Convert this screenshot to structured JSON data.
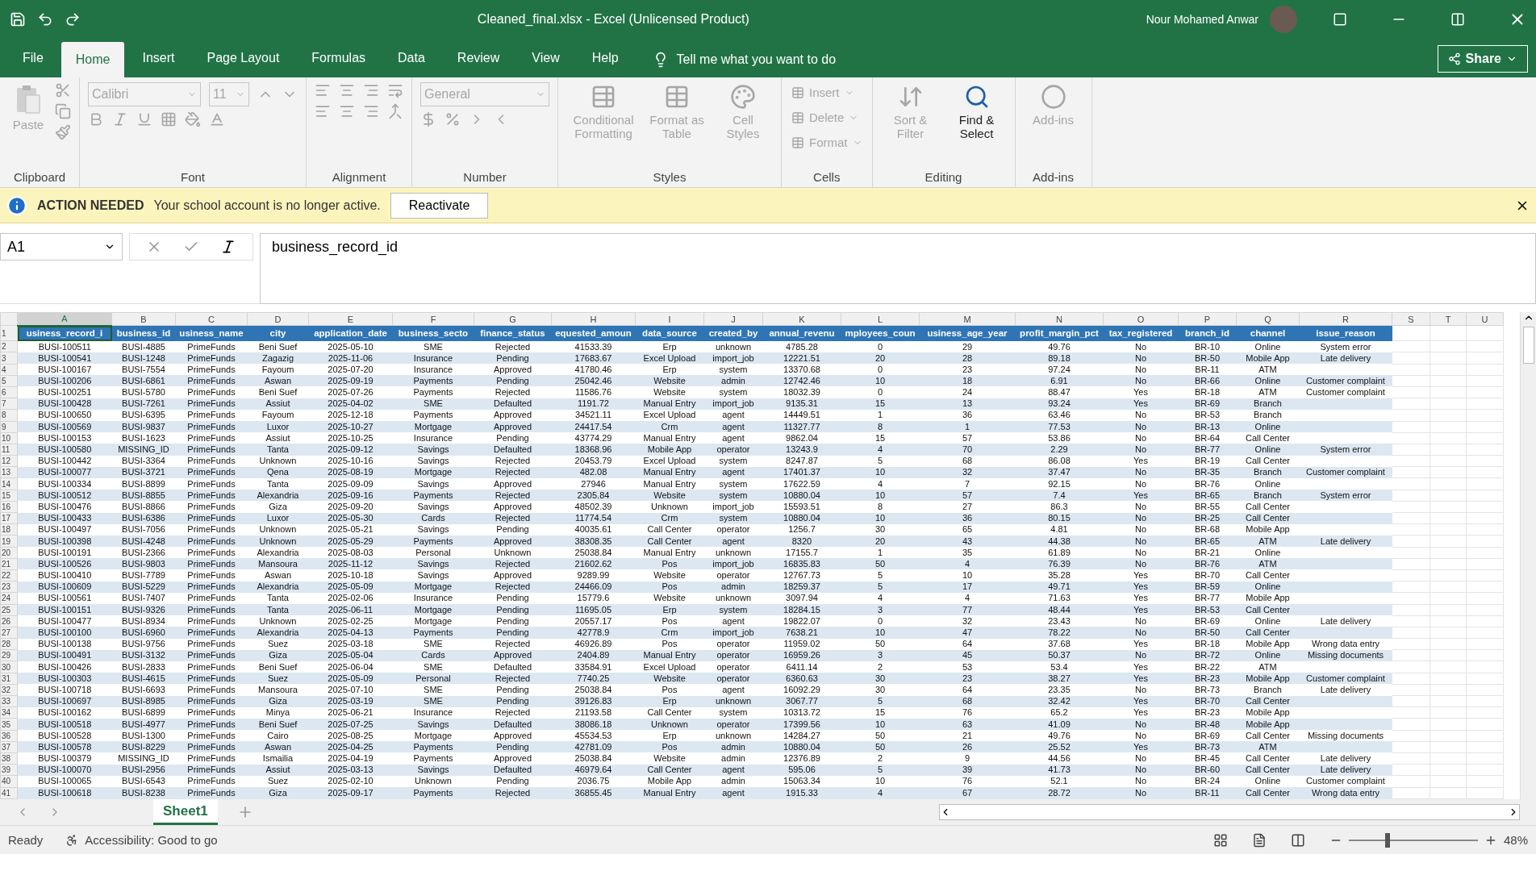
{
  "window": {
    "title": "Cleaned_final.xlsx  -  Excel (Unlicensed Product)",
    "user": "Nour Mohamed Anwar"
  },
  "ribbon_tabs": [
    {
      "label": "File",
      "selected": false
    },
    {
      "label": "Home",
      "selected": true
    },
    {
      "label": "Insert",
      "selected": false
    },
    {
      "label": "Page Layout",
      "selected": false
    },
    {
      "label": "Formulas",
      "selected": false
    },
    {
      "label": "Data",
      "selected": false
    },
    {
      "label": "Review",
      "selected": false
    },
    {
      "label": "View",
      "selected": false
    },
    {
      "label": "Help",
      "selected": false
    }
  ],
  "tell_me": "Tell me what you want to do",
  "share": "Share",
  "ribbon_groups": [
    {
      "kind": "clipboard",
      "label": "Clipboard",
      "items": [
        {
          "label": "Paste",
          "disabled": true
        }
      ]
    },
    {
      "kind": "font",
      "label": "Font",
      "font": "Calibri",
      "size": "11"
    },
    {
      "kind": "alignment",
      "label": "Alignment"
    },
    {
      "kind": "number",
      "label": "Number",
      "format": "General"
    },
    {
      "kind": "large",
      "label": "Styles",
      "items": [
        {
          "label": "Conditional Formatting",
          "disabled": true
        },
        {
          "label": "Format as Table",
          "disabled": true
        },
        {
          "label": "Cell Styles",
          "disabled": true
        }
      ]
    },
    {
      "kind": "small",
      "label": "Cells",
      "items": [
        {
          "label": "Insert",
          "disabled": true
        },
        {
          "label": "Delete",
          "disabled": true
        },
        {
          "label": "Format",
          "disabled": true
        }
      ]
    },
    {
      "kind": "large",
      "label": "Editing",
      "items": [
        {
          "label": "Sort & Filter",
          "disabled": true
        },
        {
          "label": "Find & Select",
          "disabled": false
        }
      ]
    },
    {
      "kind": "large",
      "label": "Add-ins",
      "items": [
        {
          "label": "Add-ins",
          "disabled": true
        }
      ]
    }
  ],
  "info_bar": {
    "title": "ACTION NEEDED",
    "message": "Your school account is no longer active.",
    "button": "Reactivate"
  },
  "formula_bar": {
    "name_box": "A1",
    "formula": "business_record_id"
  },
  "sheet": {
    "header_row": "1",
    "columns": [
      {
        "letter": "A",
        "header": "usiness_record_i",
        "selected": true
      },
      {
        "letter": "B",
        "header": "business_id",
        "selected": false
      },
      {
        "letter": "C",
        "header": "usiness_name",
        "selected": false
      },
      {
        "letter": "D",
        "header": "city",
        "selected": false
      },
      {
        "letter": "E",
        "header": "application_date",
        "selected": false
      },
      {
        "letter": "F",
        "header": "business_secto",
        "selected": false
      },
      {
        "letter": "G",
        "header": "finance_status",
        "selected": false
      },
      {
        "letter": "H",
        "header": "equested_amoun",
        "selected": false
      },
      {
        "letter": "I",
        "header": "data_source",
        "selected": false
      },
      {
        "letter": "J",
        "header": "created_by",
        "selected": false
      },
      {
        "letter": "K",
        "header": "annual_revenu",
        "selected": false
      },
      {
        "letter": "L",
        "header": "mployees_coun",
        "selected": false
      },
      {
        "letter": "M",
        "header": "usiness_age_year",
        "selected": false
      },
      {
        "letter": "N",
        "header": "profit_margin_pct",
        "selected": false
      },
      {
        "letter": "O",
        "header": "tax_registered",
        "selected": false
      },
      {
        "letter": "P",
        "header": "branch_id",
        "selected": false
      },
      {
        "letter": "Q",
        "header": "channel",
        "selected": false
      },
      {
        "letter": "R",
        "header": "issue_reason",
        "selected": false
      }
    ],
    "extra_columns": [
      "S",
      "T",
      "U"
    ],
    "rows": [
      {
        "n": "2",
        "cells": [
          "BUSI-100511",
          "BUSI-4885",
          "PrimeFunds",
          "Beni Suef",
          "2025-05-10",
          "SME",
          "Rejected",
          "41533.39",
          "Erp",
          "unknown",
          "4785.28",
          "0",
          "29",
          "49.76",
          "No",
          "BR-10",
          "Online",
          "System error"
        ]
      },
      {
        "n": "3",
        "cells": [
          "BUSI-100541",
          "BUSI-1248",
          "PrimeFunds",
          "Zagazig",
          "2025-11-06",
          "Insurance",
          "Pending",
          "17683.67",
          "Excel Upload",
          "import_job",
          "12221.51",
          "20",
          "28",
          "89.18",
          "No",
          "BR-50",
          "Mobile App",
          "Late delivery"
        ]
      },
      {
        "n": "4",
        "cells": [
          "BUSI-100167",
          "BUSI-7554",
          "PrimeFunds",
          "Fayoum",
          "2025-07-20",
          "Insurance",
          "Approved",
          "41780.46",
          "Erp",
          "system",
          "13370.68",
          "0",
          "23",
          "97.24",
          "No",
          "BR-11",
          "ATM"
        ]
      },
      {
        "n": "5",
        "cells": [
          "BUSI-100206",
          "BUSI-6861",
          "PrimeFunds",
          "Aswan",
          "2025-09-19",
          "Payments",
          "Pending",
          "25042.46",
          "Website",
          "admin",
          "12742.46",
          "10",
          "18",
          "6.91",
          "No",
          "BR-66",
          "Online",
          "Customer complaint"
        ]
      },
      {
        "n": "6",
        "cells": [
          "BUSI-100251",
          "BUSI-5780",
          "PrimeFunds",
          "Beni Suef",
          "2025-07-26",
          "Payments",
          "Rejected",
          "11586.76",
          "Website",
          "system",
          "18032.39",
          "0",
          "24",
          "88.47",
          "Yes",
          "BR-18",
          "ATM",
          "Customer complaint"
        ]
      },
      {
        "n": "7",
        "cells": [
          "BUSI-100428",
          "BUSI-7261",
          "PrimeFunds",
          "Assiut",
          "2025-04-02",
          "SME",
          "Defaulted",
          "1191.72",
          "Manual Entry",
          "import_job",
          "9135.31",
          "15",
          "13",
          "93.24",
          "Yes",
          "BR-69",
          "Branch"
        ]
      },
      {
        "n": "8",
        "cells": [
          "BUSI-100650",
          "BUSI-6395",
          "PrimeFunds",
          "Fayoum",
          "2025-12-18",
          "Payments",
          "Approved",
          "34521.11",
          "Excel Upload",
          "agent",
          "14449.51",
          "1",
          "36",
          "63.46",
          "No",
          "BR-53",
          "Branch"
        ]
      },
      {
        "n": "9",
        "cells": [
          "BUSI-100569",
          "BUSI-9837",
          "PrimeFunds",
          "Luxor",
          "2025-10-27",
          "Mortgage",
          "Approved",
          "24417.54",
          "Crm",
          "agent",
          "11327.77",
          "8",
          "1",
          "77.53",
          "No",
          "BR-13",
          "Online"
        ]
      },
      {
        "n": "10",
        "cells": [
          "BUSI-100153",
          "BUSI-1623",
          "PrimeFunds",
          "Assiut",
          "2025-10-25",
          "Insurance",
          "Pending",
          "43774.29",
          "Manual Entry",
          "agent",
          "9862.04",
          "15",
          "57",
          "53.86",
          "No",
          "BR-64",
          "Call Center"
        ]
      },
      {
        "n": "11",
        "cells": [
          "BUSI-100580",
          "MISSING_ID",
          "PrimeFunds",
          "Tanta",
          "2025-09-12",
          "Savings",
          "Defaulted",
          "18368.96",
          "Mobile App",
          "operator",
          "13243.9",
          "4",
          "70",
          "2.29",
          "No",
          "BR-77",
          "Online",
          "System error"
        ]
      },
      {
        "n": "12",
        "cells": [
          "BUSI-100442",
          "BUSI-3364",
          "PrimeFunds",
          "Unknown",
          "2025-10-16",
          "Savings",
          "Rejected",
          "20453.79",
          "Excel Upload",
          "system",
          "8247.87",
          "5",
          "68",
          "86.08",
          "Yes",
          "BR-19",
          "Call Center"
        ]
      },
      {
        "n": "13",
        "cells": [
          "BUSI-100077",
          "BUSI-3721",
          "PrimeFunds",
          "Qena",
          "2025-08-19",
          "Mortgage",
          "Rejected",
          "482.08",
          "Manual Entry",
          "agent",
          "17401.37",
          "10",
          "32",
          "37.47",
          "No",
          "BR-35",
          "Branch",
          "Customer complaint"
        ]
      },
      {
        "n": "14",
        "cells": [
          "BUSI-100334",
          "BUSI-8899",
          "PrimeFunds",
          "Tanta",
          "2025-09-09",
          "Savings",
          "Approved",
          "27946",
          "Manual Entry",
          "system",
          "17622.59",
          "4",
          "7",
          "92.15",
          "No",
          "BR-76",
          "Online"
        ]
      },
      {
        "n": "15",
        "cells": [
          "BUSI-100512",
          "BUSI-8855",
          "PrimeFunds",
          "Alexandria",
          "2025-09-16",
          "Payments",
          "Rejected",
          "2305.84",
          "Website",
          "system",
          "10880.04",
          "10",
          "57",
          "7.4",
          "Yes",
          "BR-65",
          "Branch",
          "System error"
        ]
      },
      {
        "n": "16",
        "cells": [
          "BUSI-100476",
          "BUSI-8866",
          "PrimeFunds",
          "Giza",
          "2025-09-20",
          "Savings",
          "Approved",
          "48502.39",
          "Unknown",
          "import_job",
          "15593.51",
          "8",
          "27",
          "86.3",
          "No",
          "BR-55",
          "Call Center"
        ]
      },
      {
        "n": "17",
        "cells": [
          "BUSI-100433",
          "BUSI-6386",
          "PrimeFunds",
          "Luxor",
          "2025-05-30",
          "Cards",
          "Rejected",
          "11774.54",
          "Crm",
          "system",
          "10880.04",
          "10",
          "36",
          "80.15",
          "No",
          "BR-25",
          "Call Center"
        ]
      },
      {
        "n": "18",
        "cells": [
          "BUSI-100497",
          "BUSI-7056",
          "PrimeFunds",
          "Unknown",
          "2025-05-21",
          "Savings",
          "Pending",
          "40035.61",
          "Call Center",
          "operator",
          "1256.7",
          "30",
          "65",
          "4.81",
          "No",
          "BR-68",
          "Mobile App"
        ]
      },
      {
        "n": "19",
        "cells": [
          "BUSI-100398",
          "BUSI-4248",
          "PrimeFunds",
          "Unknown",
          "2025-05-29",
          "Payments",
          "Approved",
          "38308.35",
          "Call Center",
          "agent",
          "8320",
          "20",
          "43",
          "44.38",
          "No",
          "BR-65",
          "ATM",
          "Late delivery"
        ]
      },
      {
        "n": "20",
        "cells": [
          "BUSI-100191",
          "BUSI-2366",
          "PrimeFunds",
          "Alexandria",
          "2025-08-03",
          "Personal",
          "Unknown",
          "25038.84",
          "Manual Entry",
          "unknown",
          "17155.7",
          "1",
          "35",
          "61.89",
          "No",
          "BR-21",
          "Online"
        ]
      },
      {
        "n": "21",
        "cells": [
          "BUSI-100526",
          "BUSI-9803",
          "PrimeFunds",
          "Mansoura",
          "2025-11-12",
          "Savings",
          "Rejected",
          "21602.62",
          "Pos",
          "import_job",
          "16835.83",
          "50",
          "4",
          "76.39",
          "No",
          "BR-76",
          "ATM"
        ]
      },
      {
        "n": "22",
        "cells": [
          "BUSI-100410",
          "BUSI-7789",
          "PrimeFunds",
          "Aswan",
          "2025-10-18",
          "Savings",
          "Approved",
          "9289.99",
          "Website",
          "operator",
          "12767.73",
          "5",
          "10",
          "35.28",
          "Yes",
          "BR-70",
          "Call Center"
        ]
      },
      {
        "n": "23",
        "cells": [
          "BUSI-100609",
          "BUSI-5229",
          "PrimeFunds",
          "Alexandria",
          "2025-05-09",
          "Mortgage",
          "Rejected",
          "24466.09",
          "Pos",
          "admin",
          "18259.37",
          "5",
          "17",
          "49.71",
          "Yes",
          "BR-59",
          "Online"
        ]
      },
      {
        "n": "24",
        "cells": [
          "BUSI-100561",
          "BUSI-7407",
          "PrimeFunds",
          "Tanta",
          "2025-02-06",
          "Insurance",
          "Pending",
          "15779.6",
          "Website",
          "unknown",
          "3097.94",
          "4",
          "4",
          "71.63",
          "Yes",
          "BR-77",
          "Mobile App"
        ]
      },
      {
        "n": "25",
        "cells": [
          "BUSI-100151",
          "BUSI-9326",
          "PrimeFunds",
          "Tanta",
          "2025-06-11",
          "Mortgage",
          "Pending",
          "11695.05",
          "Erp",
          "system",
          "18284.15",
          "3",
          "77",
          "48.44",
          "Yes",
          "BR-53",
          "Call Center"
        ]
      },
      {
        "n": "26",
        "cells": [
          "BUSI-100477",
          "BUSI-8934",
          "PrimeFunds",
          "Unknown",
          "2025-02-25",
          "Mortgage",
          "Pending",
          "20557.17",
          "Pos",
          "agent",
          "19822.07",
          "0",
          "32",
          "23.43",
          "No",
          "BR-69",
          "Online",
          "Late delivery"
        ]
      },
      {
        "n": "27",
        "cells": [
          "BUSI-100100",
          "BUSI-6960",
          "PrimeFunds",
          "Alexandria",
          "2025-04-13",
          "Payments",
          "Pending",
          "42778.9",
          "Crm",
          "import_job",
          "7638.21",
          "10",
          "47",
          "78.22",
          "No",
          "BR-50",
          "Call Center"
        ]
      },
      {
        "n": "28",
        "cells": [
          "BUSI-100138",
          "BUSI-9756",
          "PrimeFunds",
          "Suez",
          "2025-03-18",
          "SME",
          "Rejected",
          "46926.89",
          "Pos",
          "operator",
          "11959.02",
          "50",
          "64",
          "37.68",
          "Yes",
          "BR-18",
          "Mobile App",
          "Wrong data entry"
        ]
      },
      {
        "n": "29",
        "cells": [
          "BUSI-100491",
          "BUSI-3132",
          "PrimeFunds",
          "Giza",
          "2025-05-04",
          "Cards",
          "Approved",
          "2404.89",
          "Manual Entry",
          "operator",
          "16959.26",
          "3",
          "45",
          "50.37",
          "No",
          "BR-72",
          "Online",
          "Missing documents"
        ]
      },
      {
        "n": "30",
        "cells": [
          "BUSI-100426",
          "BUSI-2833",
          "PrimeFunds",
          "Beni Suef",
          "2025-06-04",
          "SME",
          "Defaulted",
          "33584.91",
          "Excel Upload",
          "operator",
          "6411.14",
          "2",
          "53",
          "53.4",
          "Yes",
          "BR-22",
          "ATM"
        ]
      },
      {
        "n": "31",
        "cells": [
          "BUSI-100303",
          "BUSI-4615",
          "PrimeFunds",
          "Suez",
          "2025-05-09",
          "Personal",
          "Rejected",
          "7740.25",
          "Website",
          "operator",
          "6360.63",
          "30",
          "23",
          "38.27",
          "Yes",
          "BR-23",
          "Mobile App",
          "Customer complaint"
        ]
      },
      {
        "n": "32",
        "cells": [
          "BUSI-100718",
          "BUSI-6693",
          "PrimeFunds",
          "Mansoura",
          "2025-07-10",
          "SME",
          "Pending",
          "25038.84",
          "Pos",
          "agent",
          "16092.29",
          "30",
          "64",
          "23.35",
          "No",
          "BR-73",
          "Branch",
          "Late delivery"
        ]
      },
      {
        "n": "33",
        "cells": [
          "BUSI-100697",
          "BUSI-8985",
          "PrimeFunds",
          "Giza",
          "2025-03-19",
          "SME",
          "Pending",
          "39126.83",
          "Erp",
          "unknown",
          "3067.77",
          "5",
          "68",
          "32.42",
          "Yes",
          "BR-70",
          "Call Center"
        ]
      },
      {
        "n": "34",
        "cells": [
          "BUSI-100162",
          "BUSI-6899",
          "PrimeFunds",
          "Minya",
          "2025-06-21",
          "Insurance",
          "Rejected",
          "21193.58",
          "Call Center",
          "system",
          "10313.72",
          "15",
          "76",
          "65.2",
          "Yes",
          "BR-23",
          "Mobile App"
        ]
      },
      {
        "n": "35",
        "cells": [
          "BUSI-100518",
          "BUSI-4977",
          "PrimeFunds",
          "Beni Suef",
          "2025-07-25",
          "Savings",
          "Defaulted",
          "38086.18",
          "Unknown",
          "operator",
          "17399.56",
          "10",
          "63",
          "41.09",
          "No",
          "BR-48",
          "Mobile App"
        ]
      },
      {
        "n": "36",
        "cells": [
          "BUSI-100528",
          "BUSI-1300",
          "PrimeFunds",
          "Cairo",
          "2025-08-25",
          "Mortgage",
          "Approved",
          "45534.53",
          "Erp",
          "unknown",
          "14284.27",
          "50",
          "21",
          "49.76",
          "No",
          "BR-69",
          "Call Center",
          "Missing documents"
        ]
      },
      {
        "n": "37",
        "cells": [
          "BUSI-100578",
          "BUSI-8229",
          "PrimeFunds",
          "Aswan",
          "2025-04-25",
          "Payments",
          "Pending",
          "42781.09",
          "Pos",
          "admin",
          "10880.04",
          "50",
          "26",
          "25.52",
          "Yes",
          "BR-73",
          "ATM"
        ]
      },
      {
        "n": "38",
        "cells": [
          "BUSI-100379",
          "MISSING_ID",
          "PrimeFunds",
          "Ismailia",
          "2025-04-19",
          "Payments",
          "Approved",
          "25038.84",
          "Website",
          "admin",
          "12376.89",
          "2",
          "9",
          "44.56",
          "No",
          "BR-45",
          "Call Center",
          "Late delivery"
        ]
      },
      {
        "n": "39",
        "cells": [
          "BUSI-100070",
          "BUSI-2956",
          "PrimeFunds",
          "Assiut",
          "2025-03-13",
          "Savings",
          "Defaulted",
          "46979.64",
          "Call Center",
          "agent",
          "595.06",
          "5",
          "39",
          "41.73",
          "No",
          "BR-60",
          "Call Center",
          "Late delivery"
        ]
      },
      {
        "n": "40",
        "cells": [
          "BUSI-100065",
          "BUSI-6543",
          "PrimeFunds",
          "Suez",
          "2025-02-10",
          "Unknown",
          "Pending",
          "2036.75",
          "Mobile App",
          "admin",
          "15063.34",
          "10",
          "76",
          "52.1",
          "No",
          "BR-24",
          "Online",
          "Customer complaint"
        ]
      },
      {
        "n": "41",
        "cells": [
          "BUSI-100618",
          "BUSI-8238",
          "PrimeFunds",
          "Giza",
          "2025-09-17",
          "Payments",
          "Rejected",
          "36855.45",
          "Manual Entry",
          "agent",
          "1915.33",
          "4",
          "67",
          "28.72",
          "No",
          "BR-11",
          "Call Center",
          "Wrong data entry"
        ]
      }
    ]
  },
  "sheet_tabs": [
    {
      "label": "Sheet1",
      "selected": true
    }
  ],
  "status_bar": {
    "mode": "Ready",
    "accessibility": "Accessibility: Good to go",
    "zoom": "48%",
    "zoom_slider": {
      "level": 0.3
    }
  }
}
